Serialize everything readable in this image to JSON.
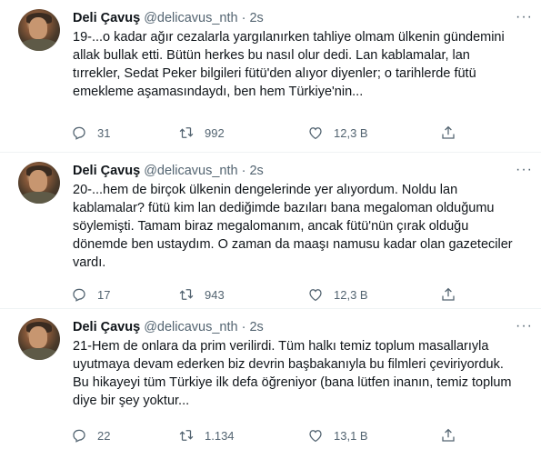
{
  "tweets": [
    {
      "name": "Deli Çavuş",
      "handle": "@delicavus_nth",
      "dot": "·",
      "time": "2s",
      "more": "···",
      "text": "19-...o kadar ağır cezalarla yargılanırken tahliye olmam ülkenin gündemini\nallak bullak etti. Bütün herkes bu nasıl olur dedi. Lan kablamalar, lan\ntırrekler, Sedat Peker bilgileri fütü'den alıyor diyenler; o tarihlerde fütü\nemekleme aşamasındaydı, ben hem Türkiye'nin...",
      "replies": "31",
      "retweets": "992",
      "likes": "12,3 B"
    },
    {
      "name": "Deli Çavuş",
      "handle": "@delicavus_nth",
      "dot": "·",
      "time": "2s",
      "more": "···",
      "text": "20-...hem de birçok ülkenin dengelerinde yer alıyordum. Noldu lan\nkablamalar? fütü kim lan dediğimde bazıları bana megaloman olduğumu\nsöylemişti. Tamam biraz megalomanım, ancak fütü'nün çırak olduğu\ndönemde ben ustaydım. O zaman da maaşı namusu kadar olan gazeteciler\nvardı.",
      "replies": "17",
      "retweets": "943",
      "likes": "12,3 B"
    },
    {
      "name": "Deli Çavuş",
      "handle": "@delicavus_nth",
      "dot": "·",
      "time": "2s",
      "more": "···",
      "text": "21-Hem de onlara da prim verilirdi. Tüm halkı temiz toplum masallarıyla\nuyutmaya devam ederken biz devrin başbakanıyla bu filmleri çeviriyorduk.\nBu hikayeyi tüm Türkiye ilk defa öğreniyor (bana lütfen inanın, temiz toplum\ndiye bir şey yoktur...",
      "replies": "22",
      "retweets": "1.134",
      "likes": "13,1 B"
    }
  ],
  "icons": {
    "reply": "reply-icon",
    "retweet": "retweet-icon",
    "like": "heart-icon",
    "share": "share-icon"
  },
  "colors": {
    "text": "#0f1419",
    "secondary": "#536471",
    "divider": "#eff3f4"
  }
}
